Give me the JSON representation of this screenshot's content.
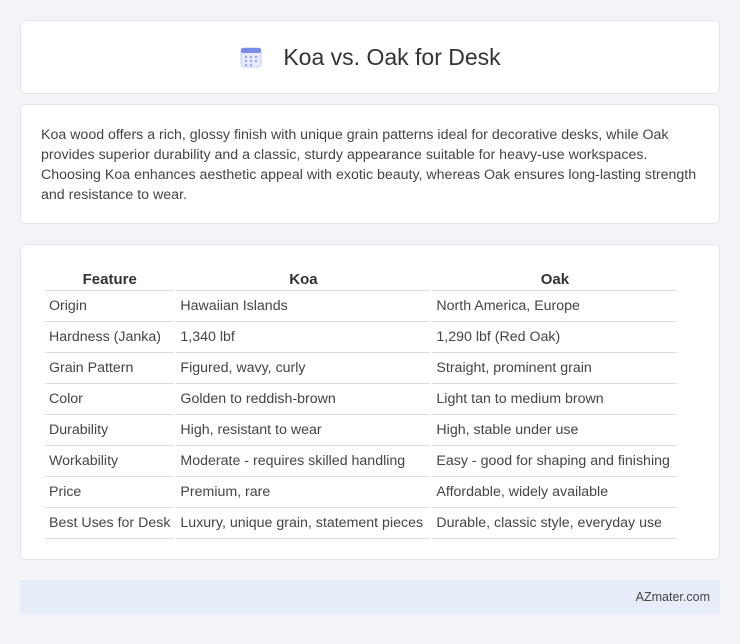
{
  "header": {
    "title": "Koa vs. Oak for Desk",
    "icon": "calendar-icon",
    "icon_color": "#6c7fe0"
  },
  "summary": {
    "text": "Koa wood offers a rich, glossy finish with unique grain patterns ideal for decorative desks, while Oak provides superior durability and a classic, sturdy appearance suitable for heavy-use workspaces. Choosing Koa enhances aesthetic appeal with exotic beauty, whereas Oak ensures long-lasting strength and resistance to wear."
  },
  "table": {
    "headers": [
      "Feature",
      "Koa",
      "Oak"
    ],
    "rows": [
      [
        "Origin",
        "Hawaiian Islands",
        "North America, Europe"
      ],
      [
        "Hardness (Janka)",
        "1,340 lbf",
        "1,290 lbf (Red Oak)"
      ],
      [
        "Grain Pattern",
        "Figured, wavy, curly",
        "Straight, prominent grain"
      ],
      [
        "Color",
        "Golden to reddish-brown",
        "Light tan to medium brown"
      ],
      [
        "Durability",
        "High, resistant to wear",
        "High, stable under use"
      ],
      [
        "Workability",
        "Moderate - requires skilled handling",
        "Easy - good for shaping and finishing"
      ],
      [
        "Price",
        "Premium, rare",
        "Affordable, widely available"
      ],
      [
        "Best Uses for Desk",
        "Luxury, unique grain, statement pieces",
        "Durable, classic style, everyday use"
      ]
    ]
  },
  "footer": {
    "brand": "AZmater.com"
  }
}
